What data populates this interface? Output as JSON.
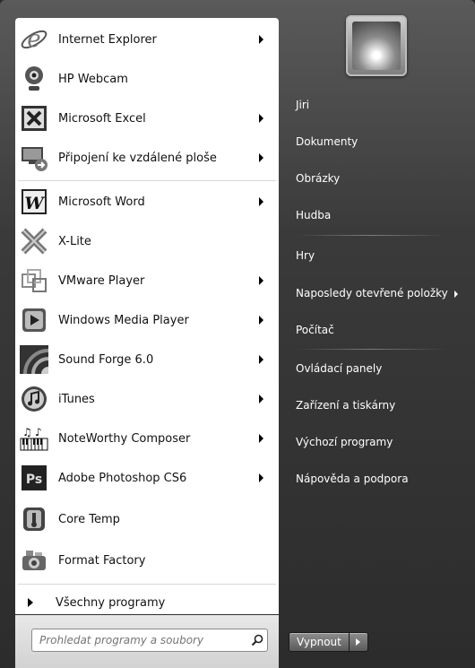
{
  "programs": [
    {
      "label": "Internet Explorer",
      "icon": "internet-explorer-icon",
      "has_submenu": true
    },
    {
      "label": "HP Webcam",
      "icon": "webcam-icon",
      "has_submenu": false
    },
    {
      "label": "Microsoft Excel",
      "icon": "excel-icon",
      "has_submenu": true
    },
    {
      "label": "Připojení ke vzdálené ploše",
      "icon": "remote-desktop-icon",
      "has_submenu": true
    },
    {
      "label": "Microsoft Word",
      "icon": "word-icon",
      "has_submenu": true
    },
    {
      "label": "X-Lite",
      "icon": "x-lite-icon",
      "has_submenu": false
    },
    {
      "label": "VMware Player",
      "icon": "vmware-icon",
      "has_submenu": true
    },
    {
      "label": "Windows Media Player",
      "icon": "media-player-icon",
      "has_submenu": true
    },
    {
      "label": "Sound Forge 6.0",
      "icon": "sound-forge-icon",
      "has_submenu": true
    },
    {
      "label": "iTunes",
      "icon": "itunes-icon",
      "has_submenu": true
    },
    {
      "label": "NoteWorthy Composer",
      "icon": "noteworthy-icon",
      "has_submenu": true
    },
    {
      "label": "Adobe Photoshop CS6",
      "icon": "photoshop-icon",
      "has_submenu": true
    },
    {
      "label": "Core Temp",
      "icon": "core-temp-icon",
      "has_submenu": false
    },
    {
      "label": "Format Factory",
      "icon": "format-factory-icon",
      "has_submenu": false
    }
  ],
  "all_programs_label": "Všechny programy",
  "search": {
    "placeholder": "Prohledat programy a soubory"
  },
  "right_menu": [
    {
      "label": "Jiri"
    },
    {
      "label": "Dokumenty"
    },
    {
      "label": "Obrázky"
    },
    {
      "label": "Hudba"
    },
    {
      "label": "Hry"
    },
    {
      "label": "Naposledy otevřené položky",
      "has_submenu": true
    },
    {
      "label": "Počítač"
    },
    {
      "label": "Ovládací panely"
    },
    {
      "label": "Zařízení a tiskárny"
    },
    {
      "label": "Výchozí programy"
    },
    {
      "label": "Nápověda a podpora"
    }
  ],
  "shutdown": {
    "label": "Vypnout"
  }
}
